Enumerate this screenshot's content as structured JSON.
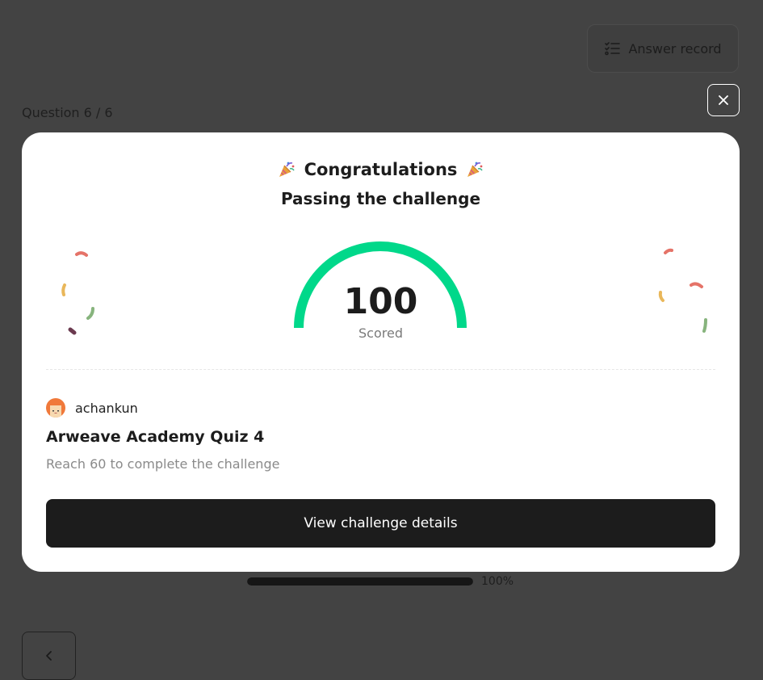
{
  "background": {
    "answer_record_label": "Answer record",
    "question_counter": "Question 6 / 6",
    "progress": {
      "value": 1.0,
      "label": "100%"
    }
  },
  "modal": {
    "title": "Congratulations",
    "subtitle": "Passing the challenge",
    "score": {
      "value": "100",
      "label": "Scored",
      "fraction": 1.0
    },
    "author": {
      "name": "achankun"
    },
    "quiz_title": "Arweave Academy Quiz 4",
    "requirement": "Reach 60 to complete the challenge",
    "details_button": "View challenge details"
  },
  "icons": {
    "answer_record": "list-icon",
    "close": "close-icon",
    "back": "chevron-left-icon",
    "party": "party-popper-icon",
    "avatar": "avatar"
  },
  "colors": {
    "overlay": "#434343",
    "gauge": "#00d88a",
    "button": "#1c1c1c",
    "confetti": [
      "#e57368",
      "#e9b75a",
      "#87b47d",
      "#6b3a4f"
    ]
  }
}
